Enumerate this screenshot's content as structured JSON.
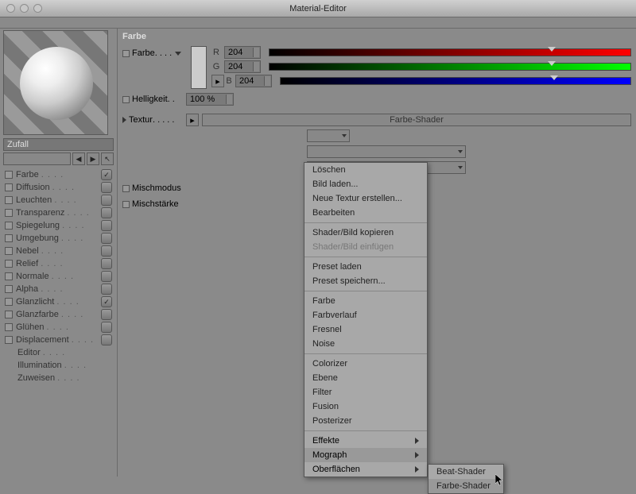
{
  "window_title": "Material-Editor",
  "material_name": "Zufall",
  "channels": [
    {
      "label": "Farbe",
      "checked": true
    },
    {
      "label": "Diffusion",
      "checked": false
    },
    {
      "label": "Leuchten",
      "checked": false
    },
    {
      "label": "Transparenz",
      "checked": false
    },
    {
      "label": "Spiegelung",
      "checked": false
    },
    {
      "label": "Umgebung",
      "checked": false
    },
    {
      "label": "Nebel",
      "checked": false
    },
    {
      "label": "Relief",
      "checked": false
    },
    {
      "label": "Normale",
      "checked": false
    },
    {
      "label": "Alpha",
      "checked": false
    },
    {
      "label": "Glanzlicht",
      "checked": true
    },
    {
      "label": "Glanzfarbe",
      "checked": false
    },
    {
      "label": "Glühen",
      "checked": false
    },
    {
      "label": "Displacement",
      "checked": false
    }
  ],
  "sub_channels": [
    "Editor",
    "Illumination",
    "Zuweisen"
  ],
  "panel_title": "Farbe",
  "color_label": "Farbe",
  "brightness_label": "Helligkeit",
  "brightness_value": "100 %",
  "texture_label": "Textur",
  "texture_value": "Farbe-Shader",
  "mix_mode_label": "Mischmodus",
  "mix_strength_label": "Mischstärke",
  "rgb": {
    "r": "204",
    "g": "204",
    "b": "204"
  },
  "menu": {
    "g1": [
      "Löschen",
      "Bild laden...",
      "Neue Textur erstellen...",
      "Bearbeiten"
    ],
    "g2": [
      "Shader/Bild kopieren"
    ],
    "g2d": [
      "Shader/Bild einfügen"
    ],
    "g3": [
      "Preset laden",
      "Preset speichern..."
    ],
    "g4": [
      "Farbe",
      "Farbverlauf",
      "Fresnel",
      "Noise"
    ],
    "g5": [
      "Colorizer",
      "Ebene",
      "Filter",
      "Fusion",
      "Posterizer"
    ],
    "g6": [
      "Effekte",
      "Mograph",
      "Oberflächen"
    ]
  },
  "submenu": [
    "Beat-Shader",
    "Farbe-Shader"
  ]
}
